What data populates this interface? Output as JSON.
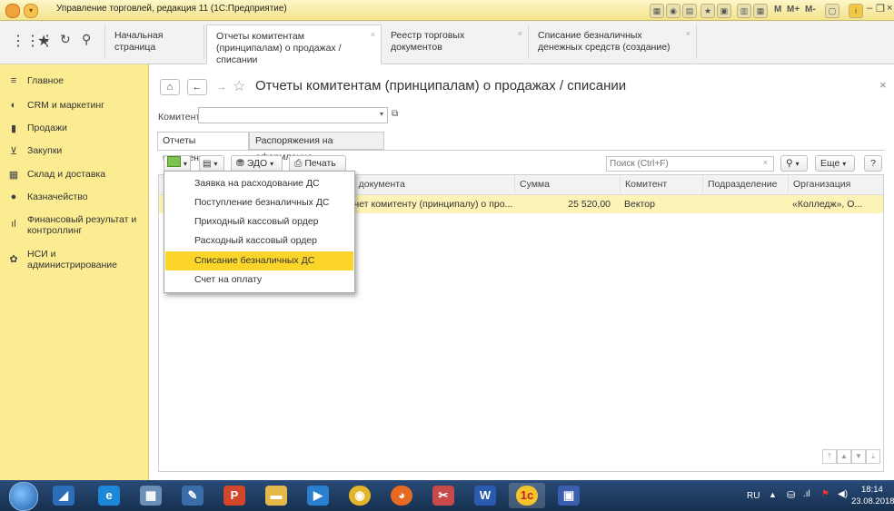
{
  "window": {
    "title": "Управление торговлей, редакция 11 (1С:Предприятие)",
    "toolbar_text": [
      "M",
      "M+",
      "M-"
    ]
  },
  "tabs": [
    {
      "label": "Начальная страница"
    },
    {
      "label": "Отчеты комитентам (принципалам) о продажах / списании",
      "active": true
    },
    {
      "label": "Реестр торговых документов"
    },
    {
      "label": "Списание безналичных денежных средств (создание)"
    }
  ],
  "sidebar": {
    "items": [
      {
        "label": "Главное",
        "icon": "menu-icon"
      },
      {
        "label": "CRM и маркетинг",
        "icon": "crm-icon"
      },
      {
        "label": "Продажи",
        "icon": "bag-icon"
      },
      {
        "label": "Закупки",
        "icon": "cart-icon"
      },
      {
        "label": "Склад и доставка",
        "icon": "warehouse-icon"
      },
      {
        "label": "Казначейство",
        "icon": "treasury-icon"
      },
      {
        "label": "Финансовый результат и контроллинг",
        "icon": "chart-icon"
      },
      {
        "label": "НСИ и администрирование",
        "icon": "gear-icon"
      }
    ]
  },
  "page": {
    "title": "Отчеты комитентам (принципалам) о продажах / списании",
    "filter_label": "Комитент:",
    "filter_value": ""
  },
  "subtabs": [
    "Отчеты комитентам",
    "Распоряжения на оформление"
  ],
  "toolbar": {
    "edo_label": "ЭДО",
    "print_label": "Печать",
    "search_placeholder": "Поиск (Ctrl+F)",
    "more_label": "Еще",
    "help_label": "?"
  },
  "table": {
    "columns": [
      "п документа",
      "Сумма",
      "Комитент",
      "Подразделение",
      "Организация"
    ],
    "rows": [
      {
        "doc": "тчет комитенту (принципалу) о про...",
        "sum": "25 520,00",
        "committent": "Вектор",
        "dept": "",
        "org": "«Колледж», О..."
      }
    ]
  },
  "dropdown": {
    "items": [
      {
        "label": "Заявка на расходование ДС"
      },
      {
        "label": "Поступление безналичных ДС"
      },
      {
        "label": "Приходный кассовый ордер"
      },
      {
        "label": "Расходный кассовый ордер"
      },
      {
        "label": "Списание безналичных ДС",
        "selected": true
      },
      {
        "label": "Счет на оплату"
      }
    ]
  },
  "taskbar": {
    "lang": "RU",
    "time": "18:14",
    "date": "23.08.2018"
  },
  "colors": {
    "sidebar": "#fbec92",
    "highlight": "#fbd52a",
    "row_selected": "#fdf3b6"
  }
}
